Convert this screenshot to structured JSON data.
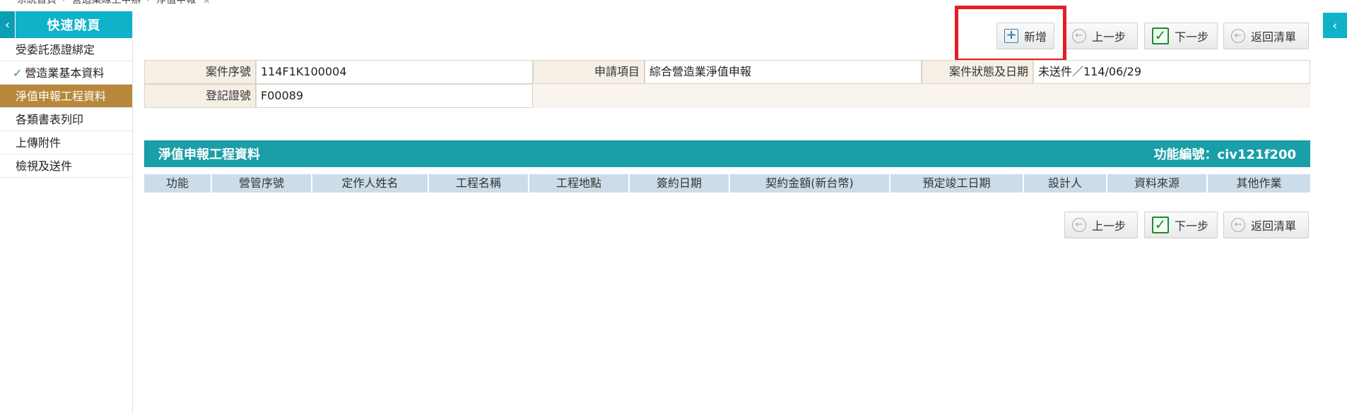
{
  "breadcrumb": {
    "items": [
      "系統首頁",
      "營造業線上申辦",
      "淨值申報"
    ]
  },
  "sidebar": {
    "title": "快速跳頁",
    "collapse_icon": "‹",
    "items": [
      {
        "label": "受委託憑證綁定",
        "check": ""
      },
      {
        "label": "營造業基本資料",
        "check": "✓"
      },
      {
        "label": "淨值申報工程資料",
        "check": ""
      },
      {
        "label": "各類書表列印",
        "check": ""
      },
      {
        "label": "上傳附件",
        "check": ""
      },
      {
        "label": "檢視及送件",
        "check": ""
      }
    ],
    "active_index": 2
  },
  "right_tab_icon": "‹",
  "toolbar": {
    "add_label": "新增",
    "prev_label": "上一步",
    "next_label": "下一步",
    "back_label": "返回清單"
  },
  "case": {
    "case_no_label": "案件序號",
    "case_no": "114F1K100004",
    "apply_item_label": "申請項目",
    "apply_item": "綜合營造業淨值申報",
    "status_label": "案件狀態及日期",
    "status": "未送件／114/06/29",
    "reg_no_label": "登記證號",
    "reg_no": "F00089"
  },
  "section": {
    "title": "淨值申報工程資料",
    "func_code": "功能編號：civ121f200"
  },
  "grid": {
    "columns": [
      "功能",
      "營管序號",
      "定作人姓名",
      "工程名稱",
      "工程地點",
      "簽約日期",
      "契約金額(新台幣)",
      "預定竣工日期",
      "設計人",
      "資料來源",
      "其他作業"
    ]
  },
  "colors": {
    "sidebar_header": "#0fb2c9",
    "sidebar_active": "#b7883b",
    "section_header": "#1a9ea8",
    "highlight": "#e41e26"
  }
}
